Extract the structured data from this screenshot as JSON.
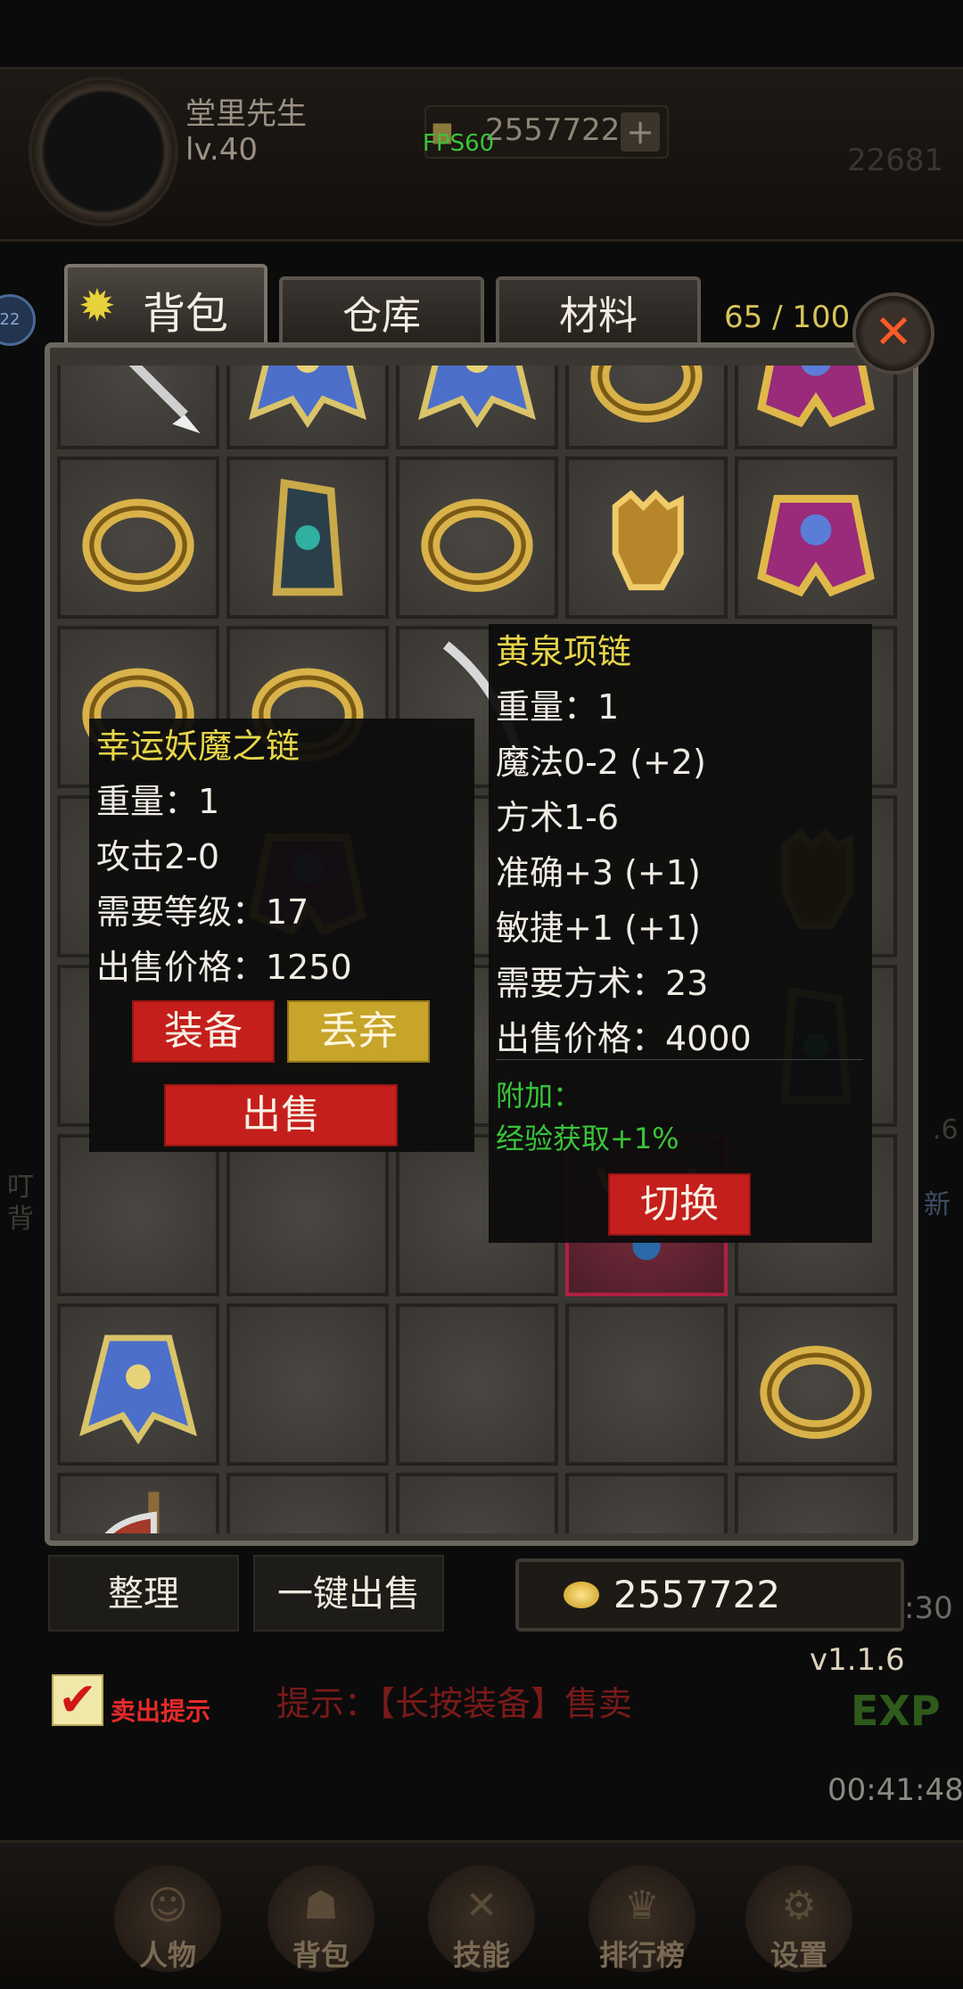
{
  "hud": {
    "player_name": "堂里先生",
    "player_level": "lv.40",
    "gold": "2557722",
    "gold_plus": "+",
    "fps": "FPS60",
    "score": "22681",
    "side_badge": "22"
  },
  "tabs": {
    "bag": "背包",
    "warehouse": "仓库",
    "material": "材料",
    "capacity": "65 / 100",
    "close": "✕"
  },
  "inventory": {
    "cells": [
      {
        "icon": "spear-icon"
      },
      {
        "icon": "robe-icon"
      },
      {
        "icon": "robe-icon"
      },
      {
        "icon": "ring-icon"
      },
      {
        "icon": "armor-icon"
      },
      {
        "icon": "ring-icon"
      },
      {
        "icon": "bracer-icon"
      },
      {
        "icon": "ring-icon"
      },
      {
        "icon": "gauntlet-icon"
      },
      {
        "icon": "armor-icon"
      },
      {
        "icon": "ring-icon"
      },
      {
        "icon": "ring-icon"
      },
      {
        "icon": "dagger-icon"
      },
      {
        "icon": "empty"
      },
      {
        "icon": "empty"
      },
      {
        "icon": "empty"
      },
      {
        "icon": "armor-icon"
      },
      {
        "icon": "empty"
      },
      {
        "icon": "empty"
      },
      {
        "icon": "gauntlet-icon"
      },
      {
        "icon": "empty"
      },
      {
        "icon": "empty"
      },
      {
        "icon": "empty"
      },
      {
        "icon": "empty"
      },
      {
        "icon": "bracer-icon"
      },
      {
        "icon": "empty"
      },
      {
        "icon": "empty"
      },
      {
        "icon": "empty"
      },
      {
        "icon": "necklace-icon"
      },
      {
        "icon": "empty"
      },
      {
        "icon": "robe-icon"
      },
      {
        "icon": "empty"
      },
      {
        "icon": "empty"
      },
      {
        "icon": "empty"
      },
      {
        "icon": "ring-icon"
      },
      {
        "icon": "axe-icon"
      },
      {
        "icon": "empty"
      },
      {
        "icon": "empty"
      },
      {
        "icon": "empty"
      },
      {
        "icon": "empty"
      }
    ]
  },
  "tooltip_left": {
    "title": "幸运妖魔之链",
    "weight": "重量：1",
    "attack": "攻击2-0",
    "required_level": "需要等级：17",
    "sell_price": "出售价格：1250",
    "equip": "装备",
    "discard": "丢弃",
    "sell": "出售"
  },
  "tooltip_right": {
    "title": "黄泉项链",
    "weight": "重量：1",
    "magic": "魔法0-2 (+2)",
    "taoism": "方术1-6",
    "accuracy": "准确+3 (+1)",
    "agility": "敏捷+1 (+1)",
    "required_taoism": "需要方术：23",
    "sell_price": "出售价格：4000",
    "extra_label": "附加：",
    "extra_value": "经验获取+1%",
    "switch": "切换"
  },
  "controls": {
    "sort": "整理",
    "sell_all": "一键出售",
    "gold": "2557722",
    "version": "v1.1.6",
    "sell_tip_checkbox": "✔",
    "sell_tip_label": "卖出提示",
    "hint": "提示：【长按装备】售卖",
    "exp_label": "EXP",
    "timer": "00:41:48",
    "time_right": ":30"
  },
  "ghost_text": {
    "level_side": ".6",
    "new_side": "新",
    "left_1": "叮",
    "left_2": "背"
  },
  "bottom_nav": [
    {
      "label": "人物",
      "icon": "character-icon"
    },
    {
      "label": "背包",
      "icon": "bag-icon"
    },
    {
      "label": "技能",
      "icon": "skill-icon"
    },
    {
      "label": "排行榜",
      "icon": "ranking-icon"
    },
    {
      "label": "设置",
      "icon": "settings-icon"
    }
  ],
  "colors": {
    "accent_gold": "#e6d54a",
    "button_red": "#c41f1c",
    "button_gold": "#c7a42a",
    "green_text": "#39c439"
  }
}
